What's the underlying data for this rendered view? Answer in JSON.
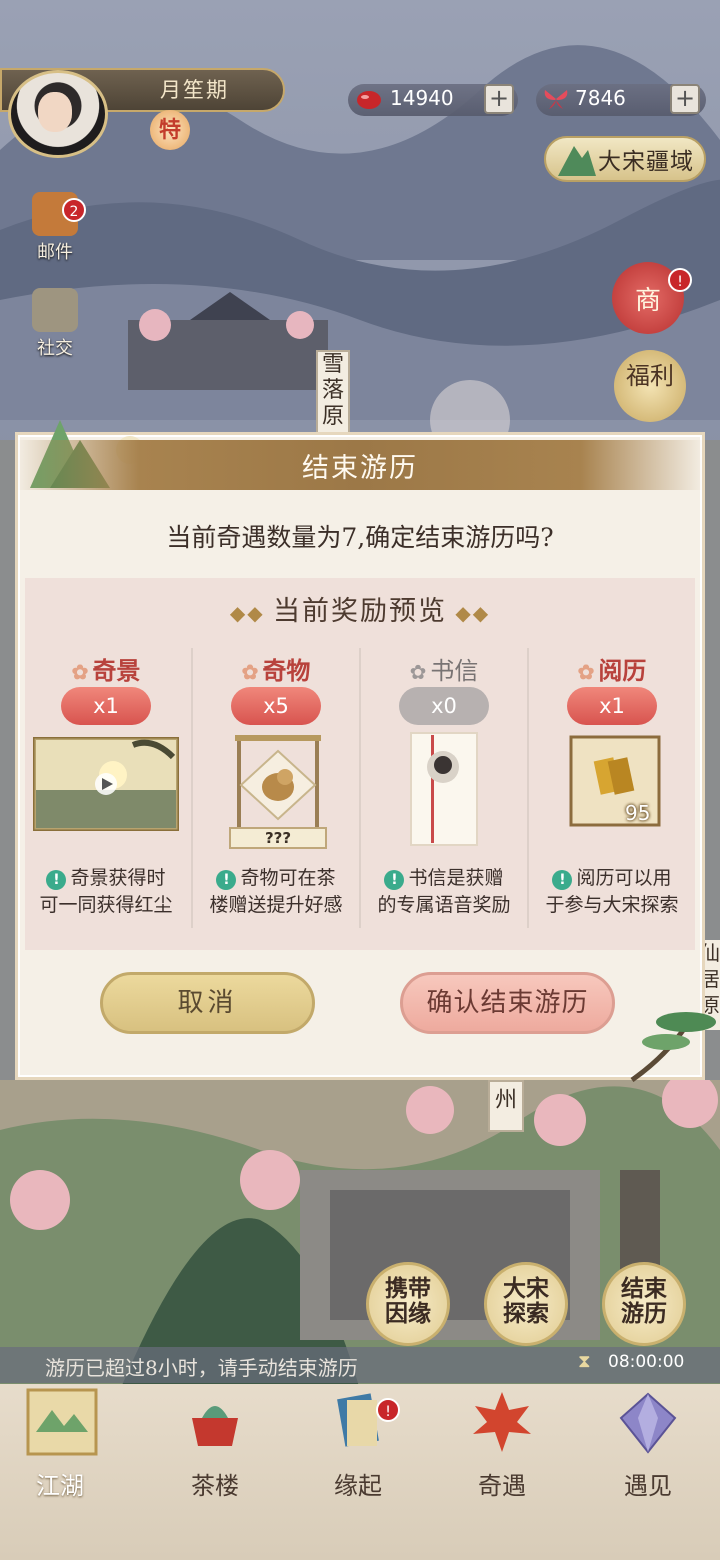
{
  "header": {
    "player_name": "月笙期",
    "vip_badge": "特",
    "resources": [
      {
        "icon": "red-bean-icon",
        "value": "14940",
        "plus": "+"
      },
      {
        "icon": "butterfly-icon",
        "value": "7846",
        "plus": "+"
      }
    ],
    "region_button": "大宋疆域"
  },
  "side_menu": [
    {
      "icon": "mail-icon",
      "label": "邮件",
      "badge": "2"
    },
    {
      "icon": "social-icon",
      "label": "社交",
      "badge": ""
    }
  ],
  "right_menu": [
    {
      "icon": "shop-icon",
      "label": "商",
      "badge": "!"
    },
    {
      "icon": "welfare-icon",
      "label": "福利"
    }
  ],
  "map_labels": {
    "snow_peak": "雪落原",
    "right_edge": "仙居原",
    "zhou": "州"
  },
  "dialog": {
    "title": "结束游历",
    "question": "当前奇遇数量为7,确定结束游历吗?",
    "reward_title": "当前奖励预览",
    "rewards": [
      {
        "name": "奇景",
        "count": "x1",
        "active": true,
        "desc_line1": "奇景获得时",
        "desc_line2": "可一同获得红尘"
      },
      {
        "name": "奇物",
        "count": "x5",
        "active": true,
        "desc_line1": "奇物可在茶",
        "desc_line2": "楼赠送提升好感",
        "tag": "???"
      },
      {
        "name": "书信",
        "count": "x0",
        "active": false,
        "desc_line1": "书信是获赠",
        "desc_line2": "的专属语音奖励"
      },
      {
        "name": "阅历",
        "count": "x1",
        "active": true,
        "desc_line1": "阅历可以用",
        "desc_line2": "于参与大宋探索",
        "amount": "95"
      }
    ],
    "cancel_button": "取消",
    "confirm_button": "确认结束游历"
  },
  "actions": [
    {
      "line1": "携带",
      "line2": "因缘"
    },
    {
      "line1": "大宋",
      "line2": "探索"
    },
    {
      "line1": "结束",
      "line2": "游历"
    }
  ],
  "notice": {
    "text": "游历已超过8小时，请手动结束游历",
    "timer": "08:00:00"
  },
  "bottom_nav": [
    {
      "label": "江湖",
      "icon": "map-scroll-icon",
      "active": true
    },
    {
      "label": "茶楼",
      "icon": "teacup-icon",
      "active": false
    },
    {
      "label": "缘起",
      "icon": "book-icon",
      "active": false,
      "badge": "!"
    },
    {
      "label": "奇遇",
      "icon": "maple-leaf-icon",
      "active": false
    },
    {
      "label": "遇见",
      "icon": "crystal-icon",
      "active": false
    }
  ],
  "colors": {
    "accent_red": "#d8544f",
    "gold": "#c6a86a",
    "dialog_bg": "#f5f0e7",
    "reward_panel": "#efe0da"
  }
}
